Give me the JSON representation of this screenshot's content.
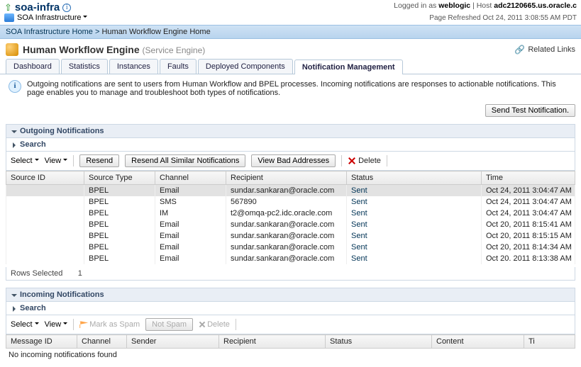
{
  "header": {
    "app_name": "soa-infra",
    "logged_in_prefix": "Logged in as ",
    "logged_in_user": "weblogic",
    "host_label": "Host",
    "host_value": "adc2120665.us.oracle.c",
    "infra_label": "SOA Infrastructure",
    "refreshed": "Page Refreshed Oct 24, 2011 3:08:55 AM PDT"
  },
  "breadcrumb": {
    "a": "SOA Infrastructure Home",
    "b": "Human Workflow Engine Home"
  },
  "title": {
    "main": "Human Workflow Engine",
    "sub": "(Service Engine)",
    "related": "Related Links"
  },
  "tabs": [
    "Dashboard",
    "Statistics",
    "Instances",
    "Faults",
    "Deployed Components",
    "Notification Management"
  ],
  "hint": "Outgoing notifications are sent to users from Human Workflow and BPEL processes. Incoming notifications are responses to actionable notifications. This page enables you to manage and troubleshoot both types of notifications.",
  "buttons": {
    "send_test": "Send Test Notification.",
    "select": "Select",
    "view": "View",
    "resend": "Resend",
    "resend_all": "Resend All Similar Notifications",
    "view_bad": "View Bad Addresses",
    "delete": "Delete",
    "mark_spam": "Mark as Spam",
    "not_spam": "Not Spam"
  },
  "outgoing": {
    "heading": "Outgoing Notifications",
    "search": "Search",
    "cols": [
      "Source ID",
      "Source Type",
      "Channel",
      "Recipient",
      "Status",
      "Time"
    ],
    "rows": [
      {
        "src_type": "BPEL",
        "channel": "Email",
        "recipient": "sundar.sankaran@oracle.com",
        "status": "Sent",
        "time": "Oct 24, 2011 3:04:47 AM"
      },
      {
        "src_type": "BPEL",
        "channel": "SMS",
        "recipient": "567890",
        "status": "Sent",
        "time": "Oct 24, 2011 3:04:47 AM"
      },
      {
        "src_type": "BPEL",
        "channel": "IM",
        "recipient": "t2@omqa-pc2.idc.oracle.com",
        "status": "Sent",
        "time": "Oct 24, 2011 3:04:47 AM"
      },
      {
        "src_type": "BPEL",
        "channel": "Email",
        "recipient": "sundar.sankaran@oracle.com",
        "status": "Sent",
        "time": "Oct 20, 2011 8:15:41 AM"
      },
      {
        "src_type": "BPEL",
        "channel": "Email",
        "recipient": "sundar.sankaran@oracle.com",
        "status": "Sent",
        "time": "Oct 20, 2011 8:15:15 AM"
      },
      {
        "src_type": "BPEL",
        "channel": "Email",
        "recipient": "sundar.sankaran@oracle.com",
        "status": "Sent",
        "time": "Oct 20, 2011 8:14:34 AM"
      },
      {
        "src_type": "BPEL",
        "channel": "Email",
        "recipient": "sundar.sankaran@oracle.com",
        "status": "Sent",
        "time": "Oct 20. 2011 8:13:38 AM"
      }
    ],
    "rows_selected_label": "Rows Selected",
    "rows_selected_count": "1"
  },
  "incoming": {
    "heading": "Incoming Notifications",
    "search": "Search",
    "cols": [
      "Message ID",
      "Channel",
      "Sender",
      "Recipient",
      "Status",
      "Content",
      "Ti"
    ],
    "empty": "No incoming notifications found"
  }
}
